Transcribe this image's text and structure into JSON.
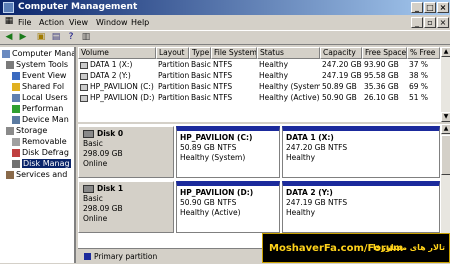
{
  "window": {
    "title": "Computer Management"
  },
  "menu": [
    "File",
    "Action",
    "View",
    "Window",
    "Help"
  ],
  "toolbar_icons": [
    "back-icon",
    "forward-icon",
    "up-folder-icon",
    "properties-icon",
    "help-icon",
    "console-icon"
  ],
  "tree": [
    {
      "label": "Computer Manag",
      "level": 0,
      "icon": "computer-icon"
    },
    {
      "label": "System Tools",
      "level": 1,
      "icon": "tools-icon"
    },
    {
      "label": "Event View",
      "level": 2,
      "icon": "event-viewer-icon"
    },
    {
      "label": "Shared Fol",
      "level": 2,
      "icon": "shared-folders-icon"
    },
    {
      "label": "Local Users",
      "level": 2,
      "icon": "users-icon"
    },
    {
      "label": "Performan",
      "level": 2,
      "icon": "performance-icon"
    },
    {
      "label": "Device Man",
      "level": 2,
      "icon": "device-manager-icon"
    },
    {
      "label": "Storage",
      "level": 1,
      "icon": "storage-icon"
    },
    {
      "label": "Removable",
      "level": 2,
      "icon": "removable-storage-icon"
    },
    {
      "label": "Disk Defrag",
      "level": 2,
      "icon": "defrag-icon"
    },
    {
      "label": "Disk Manag",
      "level": 2,
      "icon": "disk-management-icon",
      "selected": true
    },
    {
      "label": "Services and",
      "level": 1,
      "icon": "services-icon"
    }
  ],
  "columns": [
    "Volume",
    "Layout",
    "Type",
    "File System",
    "Status",
    "Capacity",
    "Free Space",
    "% Free"
  ],
  "volumes": [
    [
      "DATA 1 (X:)",
      "Partition",
      "Basic",
      "NTFS",
      "Healthy",
      "247.20 GB",
      "93.90 GB",
      "37 %"
    ],
    [
      "DATA 2 (Y:)",
      "Partition",
      "Basic",
      "NTFS",
      "Healthy",
      "247.19 GB",
      "95.58 GB",
      "38 %"
    ],
    [
      "HP_PAVILION (C:)",
      "Partition",
      "Basic",
      "NTFS",
      "Healthy (System)",
      "50.89 GB",
      "35.36 GB",
      "69 %"
    ],
    [
      "HP_PAVILION (D:)",
      "Partition",
      "Basic",
      "NTFS",
      "Healthy (Active)",
      "50.90 GB",
      "26.10 GB",
      "51 %"
    ]
  ],
  "disks": [
    {
      "name": "Disk 0",
      "type": "Basic",
      "size": "298.09 GB",
      "status": "Online",
      "partitions": [
        {
          "name": "HP_PAVILION  (C:)",
          "size": "50.89 GB NTFS",
          "status": "Healthy (System)"
        },
        {
          "name": "DATA 1  (X:)",
          "size": "247.20 GB NTFS",
          "status": "Healthy"
        }
      ]
    },
    {
      "name": "Disk 1",
      "type": "Basic",
      "size": "298.09 GB",
      "status": "Online",
      "partitions": [
        {
          "name": "HP_PAVILION  (D:)",
          "size": "50.90 GB NTFS",
          "status": "Healthy (Active)"
        },
        {
          "name": "DATA 2  (Y:)",
          "size": "247.19 GB NTFS",
          "status": "Healthy"
        }
      ]
    }
  ],
  "legend": {
    "label": "Primary partition",
    "color": "#1b2a9c"
  },
  "watermark": {
    "left": "MoshaverFa.com/Forum",
    "right": "تالار های مشاورفا"
  },
  "colors": {
    "title_start": "#0a246a",
    "title_end": "#a6caf0",
    "partition_bar": "#1b2a9c"
  }
}
